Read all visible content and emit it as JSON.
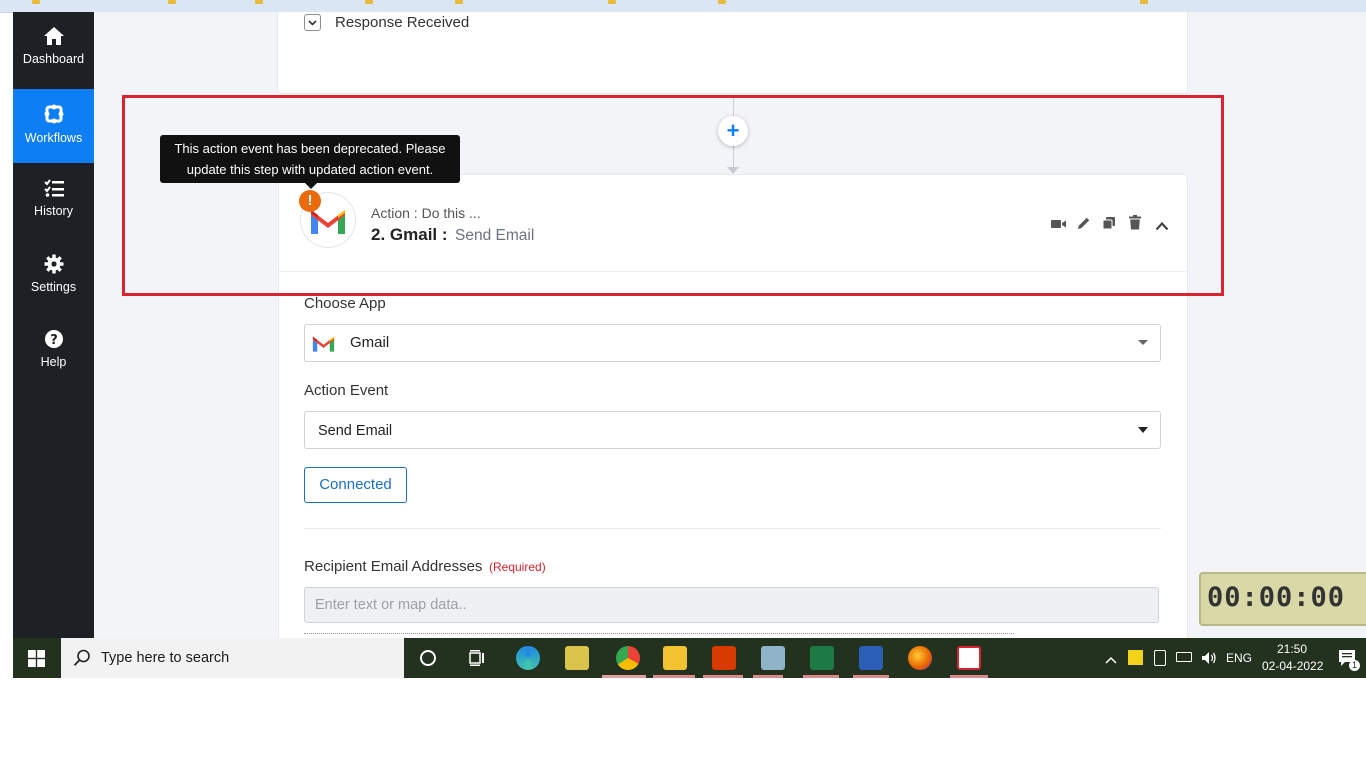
{
  "sidebar": {
    "items": [
      {
        "label": "Dashboard",
        "icon": "home-icon"
      },
      {
        "label": "Workflows",
        "icon": "workflows-icon",
        "active": true
      },
      {
        "label": "History",
        "icon": "history-list-icon"
      },
      {
        "label": "Settings",
        "icon": "gear-icon"
      },
      {
        "label": "Help",
        "icon": "question-circle-icon"
      }
    ]
  },
  "trigger_card": {
    "response_received_label": "Response Received"
  },
  "tooltip": {
    "line1": "This action event has been deprecated. Please",
    "line2": "update this step with updated action event."
  },
  "action_step": {
    "subtitle": "Action : Do this ...",
    "title_prefix": "2. Gmail :",
    "title_event": "Send Email",
    "warning_symbol": "!"
  },
  "form": {
    "choose_app_label": "Choose App",
    "app_value": "Gmail",
    "action_event_label": "Action Event",
    "action_event_value": "Send Email",
    "connected_button": "Connected",
    "recipient_label": "Recipient Email Addresses",
    "required_tag": "(Required)",
    "recipient_placeholder": "Enter text or map data.."
  },
  "timer": {
    "display": "00:00:00"
  },
  "taskbar": {
    "search_placeholder": "Type here to search",
    "language": "ENG",
    "time": "21:50",
    "date": "02-04-2022",
    "notification_count": "1"
  },
  "colors": {
    "sidebar_bg": "#1d2125",
    "active_nav": "#0d7ef3",
    "highlight_border": "#d9232e",
    "warning": "#ea6a0c",
    "link_blue": "#1b6ec2",
    "required_red": "#d9232e"
  }
}
